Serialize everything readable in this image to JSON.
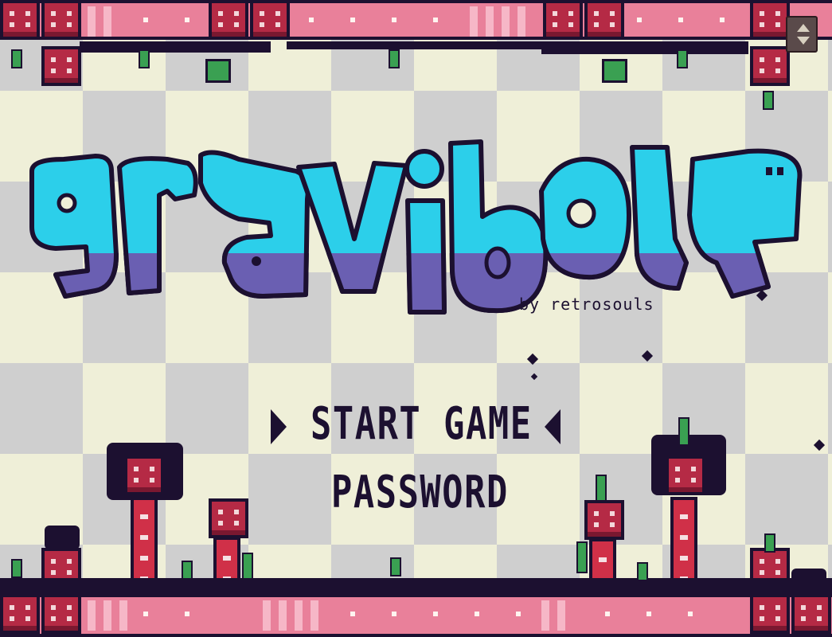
{
  "game": {
    "title": "gravibola",
    "byline": "by retrosouls"
  },
  "menu": {
    "items": [
      {
        "label": "START GAME",
        "selected": true
      },
      {
        "label": "PASSWORD",
        "selected": false
      }
    ]
  },
  "colors": {
    "background_light": "#efefd8",
    "background_dark": "#cfcfcf",
    "logo_top": "#2ccfea",
    "logo_bottom": "#6a5fb2",
    "outline": "#1c1030",
    "rail": "#e9809a",
    "block": "#b52a45",
    "grass": "#3aa052"
  },
  "icons": {
    "menu_cursor": "triangle-cursor",
    "scroll": "up-down-arrows"
  }
}
